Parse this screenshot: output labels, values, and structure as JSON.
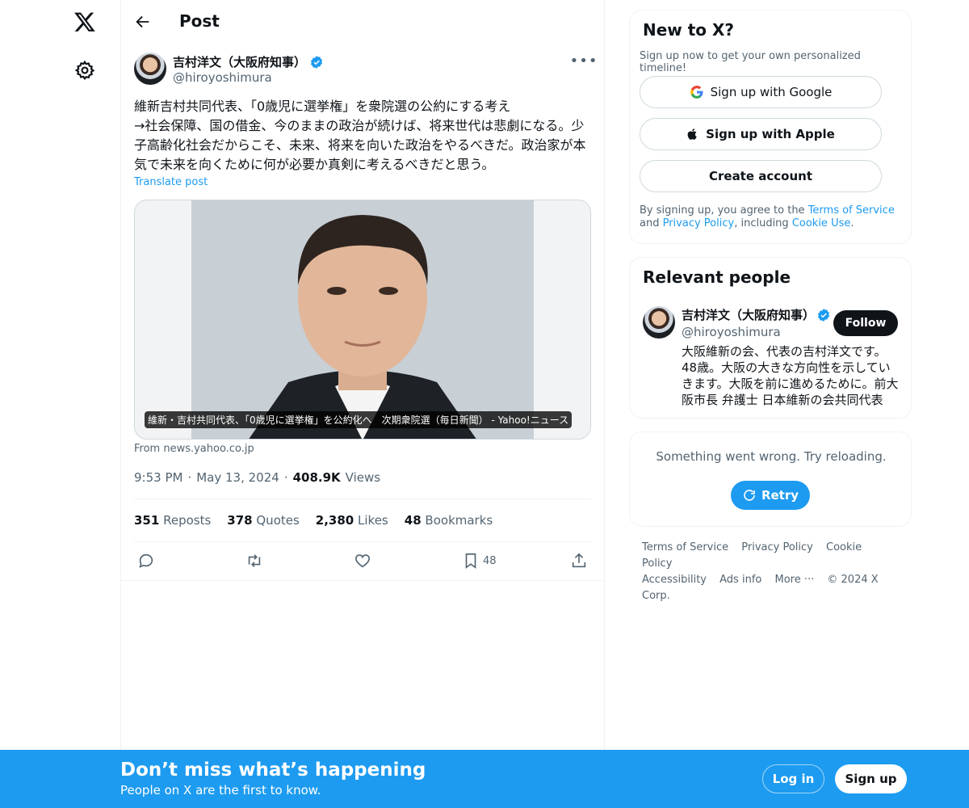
{
  "nav": {
    "logo_icon": "x-logo-icon",
    "settings_icon": "gear-icon"
  },
  "header": {
    "title": "Post"
  },
  "post": {
    "author_name": "吉村洋文（大阪府知事）",
    "author_handle": "@hiroyoshimura",
    "text": "維新吉村共同代表、「0歳児に選挙権」を衆院選の公約にする考え\n→社会保障、国の借金、今のままの政治が続けば、将来世代は悲劇になる。少子高齢化社会だからこそ、未来、将来を向いた政治をやるべきだ。政治家が本気で未来を向くために何が必要か真剣に考えるべきだと思う。",
    "translate_label": "Translate post",
    "card_caption": "維新・吉村共同代表、「0歳児に選挙権」を公約化へ　次期衆院選（毎日新聞） - Yahoo!ニュース",
    "card_source": "From news.yahoo.co.jp",
    "time": "9:53 PM",
    "date": "May 13, 2024",
    "views_count": "408.9K",
    "views_label": "Views",
    "stats": [
      {
        "count": "351",
        "label": "Reposts"
      },
      {
        "count": "378",
        "label": "Quotes"
      },
      {
        "count": "2,380",
        "label": "Likes"
      },
      {
        "count": "48",
        "label": "Bookmarks"
      }
    ],
    "bookmark_count": "48"
  },
  "signup_panel": {
    "title": "New to X?",
    "subtitle": "Sign up now to get your own personalized timeline!",
    "google_label": "Sign up with Google",
    "apple_label": "Sign up with Apple",
    "create_label": "Create account",
    "legal_prefix": "By signing up, you agree to the ",
    "terms": "Terms of Service",
    "and": " and ",
    "privacy": "Privacy Policy",
    "including": ", including ",
    "cookie": "Cookie Use",
    "period": "."
  },
  "relevant": {
    "title": "Relevant people",
    "name": "吉村洋文（大阪府知事）",
    "handle": "@hiroyoshimura",
    "follow_label": "Follow",
    "bio": "大阪維新の会、代表の吉村洋文です。48歳。大阪の大きな方向性を示していきます。大阪を前に進めるために。前大阪市長 弁護士 日本維新の会共同代表"
  },
  "error_panel": {
    "message": "Something went wrong. Try reloading.",
    "retry_label": "Retry"
  },
  "footer": {
    "links": [
      "Terms of Service",
      "Privacy Policy",
      "Cookie Policy",
      "Accessibility",
      "Ads info",
      "More ···",
      "© 2024 X Corp."
    ]
  },
  "bottom_bar": {
    "title": "Don’t miss what’s happening",
    "subtitle": "People on X are the first to know.",
    "login_label": "Log in",
    "signup_label": "Sign up"
  },
  "colors": {
    "accent": "#1d9bf0",
    "text": "#0f1419",
    "muted": "#536471"
  }
}
